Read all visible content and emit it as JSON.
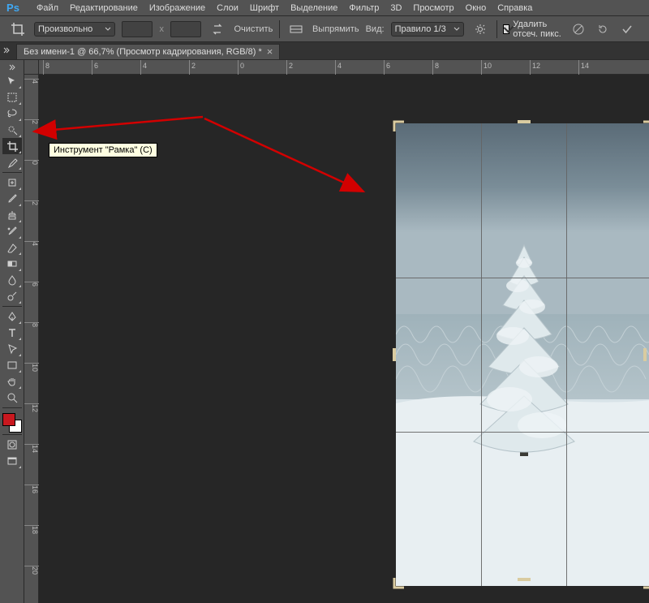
{
  "app": {
    "logo_text": "Ps"
  },
  "menu": {
    "items": [
      "Файл",
      "Редактирование",
      "Изображение",
      "Слои",
      "Шрифт",
      "Выделение",
      "Фильтр",
      "3D",
      "Просмотр",
      "Окно",
      "Справка"
    ]
  },
  "options": {
    "ratio_label": "Произвольно",
    "x_sep": "x",
    "clear_label": "Очистить",
    "straighten_label": "Выпрямить",
    "view_prefix": "Вид:",
    "view_value": "Правило 1/3",
    "delete_cropped_label": "Удалить отсеч. пикс."
  },
  "tab": {
    "title": "Без имени-1 @ 66,7% (Просмотр кадрирования, RGB/8) *",
    "close": "×"
  },
  "ruler_h": [
    "8",
    "6",
    "4",
    "2",
    "0",
    "2",
    "4",
    "6",
    "8",
    "10",
    "12",
    "14"
  ],
  "ruler_v": [
    "4",
    "2",
    "0",
    "2",
    "4",
    "6",
    "8",
    "10",
    "12",
    "14",
    "16",
    "18",
    "20"
  ],
  "tooltip": {
    "text": "Инструмент \"Рамка\" (C)"
  },
  "tools": {
    "names": [
      "move-tool",
      "rect-marquee-tool",
      "lasso-tool",
      "quick-select-tool",
      "crop-tool",
      "eyedropper-tool",
      "spot-heal-tool",
      "brush-tool",
      "clone-stamp-tool",
      "history-brush-tool",
      "eraser-tool",
      "gradient-tool",
      "blur-tool",
      "dodge-tool",
      "pen-tool",
      "type-tool",
      "path-select-tool",
      "rectangle-tool",
      "hand-tool",
      "zoom-tool"
    ]
  },
  "colors": {
    "fg": "#c9181f",
    "bg": "#ffffff",
    "ui_bg": "#535353",
    "canvas_bg": "#262626"
  }
}
